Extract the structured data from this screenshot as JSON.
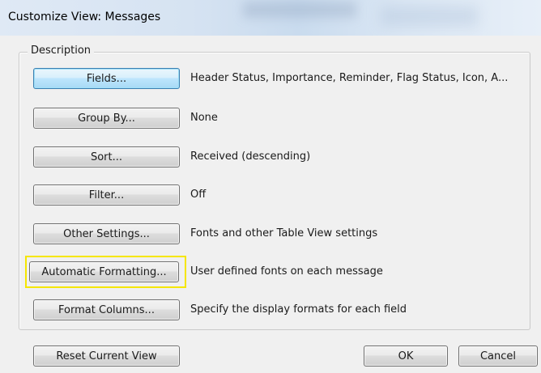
{
  "window": {
    "title": "Customize View: Messages"
  },
  "group": {
    "legend": "Description"
  },
  "rows": [
    {
      "button": "Fields...",
      "description": "Header Status, Importance, Reminder, Flag Status, Icon, A..."
    },
    {
      "button": "Group By...",
      "description": "None"
    },
    {
      "button": "Sort...",
      "description": "Received (descending)"
    },
    {
      "button": "Filter...",
      "description": "Off"
    },
    {
      "button": "Other Settings...",
      "description": "Fonts and other Table View settings"
    },
    {
      "button": "Automatic Formatting...",
      "description": "User defined fonts on each message"
    },
    {
      "button": "Format Columns...",
      "description": "Specify the display formats for each field"
    }
  ],
  "footer": {
    "reset_label": "Reset Current View",
    "ok_label": "OK",
    "cancel_label": "Cancel"
  },
  "colors": {
    "highlight": "#f5e600",
    "focus_border": "#3c7fb1"
  }
}
